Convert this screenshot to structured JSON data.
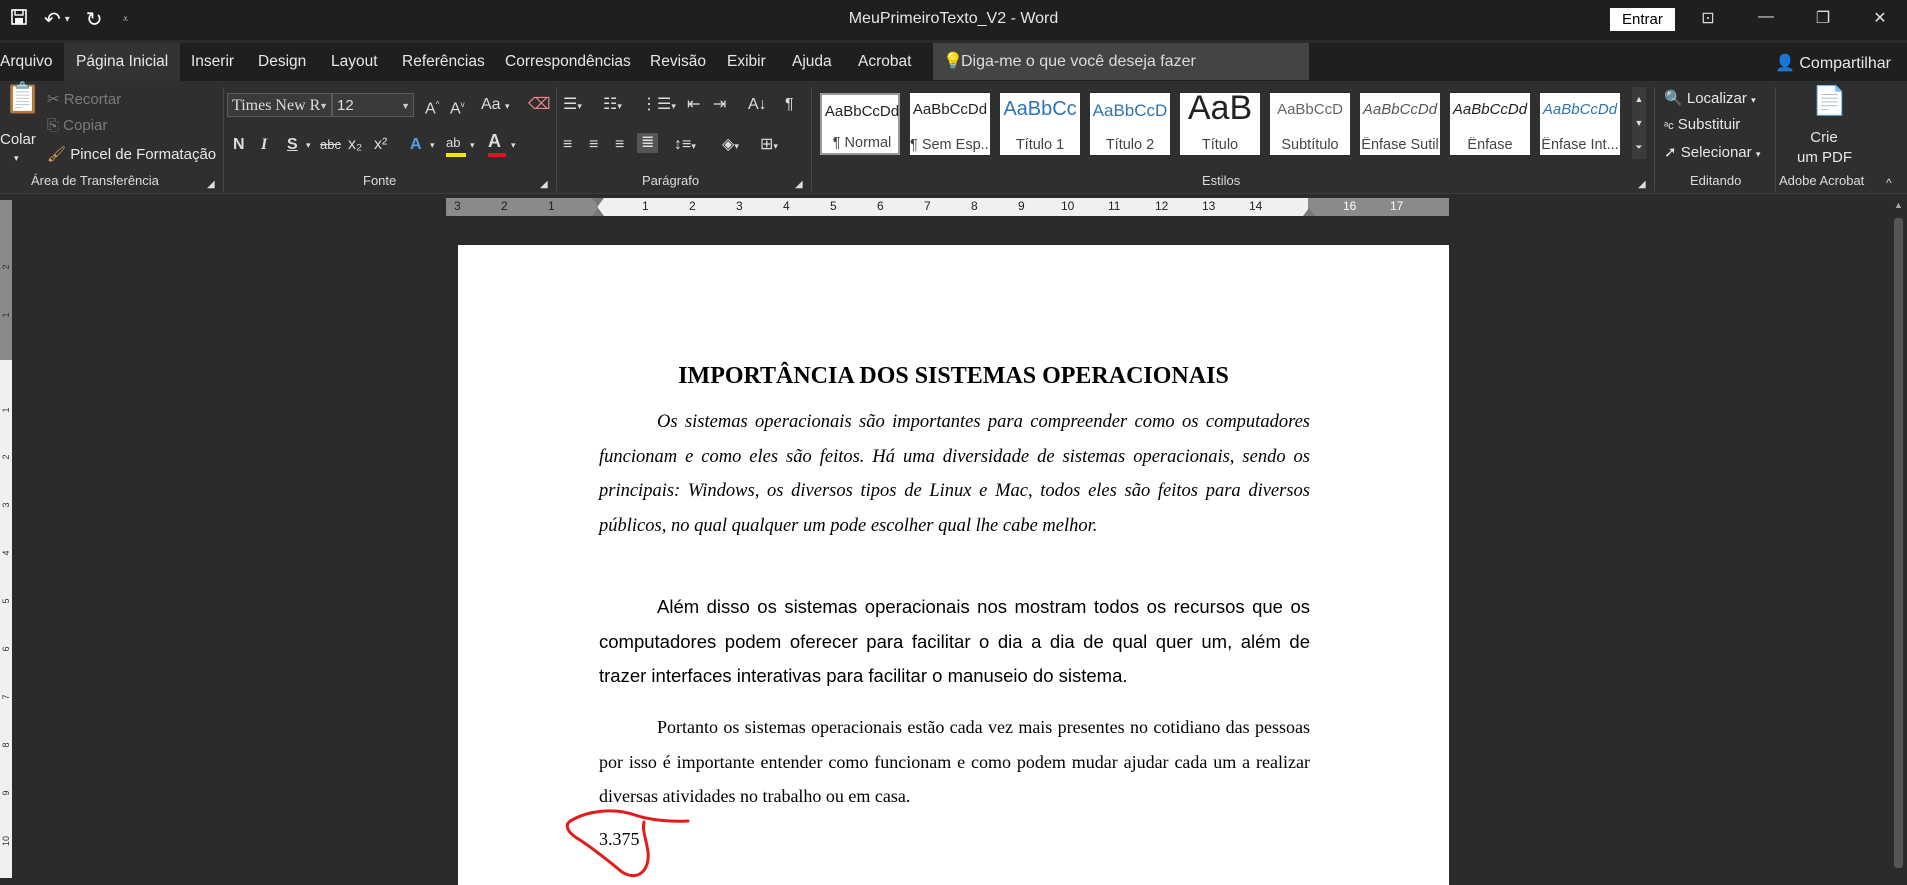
{
  "titlebar": {
    "title": "MeuPrimeiroTexto_V2  -  Word",
    "signin_label": "Entrar",
    "qat_icons": [
      "save-icon",
      "undo-icon",
      "redo-icon",
      "customize-icon"
    ]
  },
  "menu": {
    "tabs": [
      "Arquivo",
      "Página Inicial",
      "Inserir",
      "Design",
      "Layout",
      "Referências",
      "Correspondências",
      "Revisão",
      "Exibir",
      "Ajuda",
      "Acrobat"
    ],
    "active_tab": "Página Inicial",
    "tellme_placeholder": "Diga-me o que você deseja fazer",
    "share_label": "Compartilhar"
  },
  "ribbon": {
    "clipboard": {
      "paste_label": "Colar",
      "cut_label": "Recortar",
      "copy_label": "Copiar",
      "format_painter_label": "Pincel de Formatação",
      "group_label": "Área de Transferência"
    },
    "font": {
      "font_name": "Times New R",
      "font_size": "12",
      "bold": "N",
      "italic": "I",
      "underline": "S",
      "strike": "abc",
      "subscript": "x₂",
      "superscript": "x²",
      "grow": "A",
      "shrink": "A",
      "case": "Aa",
      "group_label": "Fonte",
      "colors": {
        "highlight": "#f7e600",
        "font_color": "#e81123"
      }
    },
    "paragraph": {
      "group_label": "Parágrafo"
    },
    "styles": {
      "group_label": "Estilos",
      "items": [
        {
          "preview": "AaBbCcDd",
          "name": "¶ Normal"
        },
        {
          "preview": "AaBbCcDd",
          "name": "¶ Sem Esp..."
        },
        {
          "preview": "AaBbCc",
          "name": "Título 1"
        },
        {
          "preview": "AaBbCcD",
          "name": "Título 2"
        },
        {
          "preview": "AaB",
          "name": "Título"
        },
        {
          "preview": "AaBbCcD",
          "name": "Subtítulo"
        },
        {
          "preview": "AaBbCcDd",
          "name": "Ênfase Sutil"
        },
        {
          "preview": "AaBbCcDd",
          "name": "Ênfase"
        },
        {
          "preview": "AaBbCcDd",
          "name": "Ênfase Int..."
        }
      ]
    },
    "editing": {
      "find_label": "Localizar",
      "replace_label": "Substituir",
      "select_label": "Selecionar",
      "group_label": "Editando"
    },
    "acrobat": {
      "create_line1": "Crie",
      "create_line2": "um PDF",
      "group_label": "Adobe Acrobat"
    }
  },
  "ruler": {
    "labels": [
      "3",
      "2",
      "1",
      "1",
      "2",
      "3",
      "4",
      "5",
      "6",
      "7",
      "8",
      "9",
      "10",
      "11",
      "12",
      "13",
      "14",
      "16",
      "17"
    ],
    "vertical_labels": [
      "2",
      "1",
      "1",
      "2",
      "3",
      "4",
      "5",
      "6",
      "7",
      "8",
      "9",
      "10"
    ]
  },
  "document": {
    "title": "IMPORTÂNCIA DOS SISTEMAS OPERACIONAIS",
    "p1": "Os sistemas operacionais são importantes para compreender como os computadores funcionam e como eles são feitos. Há uma diversidade de sistemas operacionais, sendo os principais: Windows, os diversos tipos de Linux e Mac, todos eles são feitos para diversos públicos, no qual qualquer um pode escolher qual lhe cabe melhor.",
    "p2": "Além disso os sistemas operacionais nos mostram todos os recursos que os computadores podem oferecer para facilitar o dia a dia de qual quer um, além de trazer interfaces interativas para facilitar o manuseio do sistema.",
    "p3": "Portanto os sistemas operacionais estão cada vez mais presentes no cotidiano das pessoas por isso é importante entender como funcionam e como podem mudar ajudar cada um a realizar diversas atividades no trabalho ou em casa.",
    "word_count_note": "3.375"
  }
}
